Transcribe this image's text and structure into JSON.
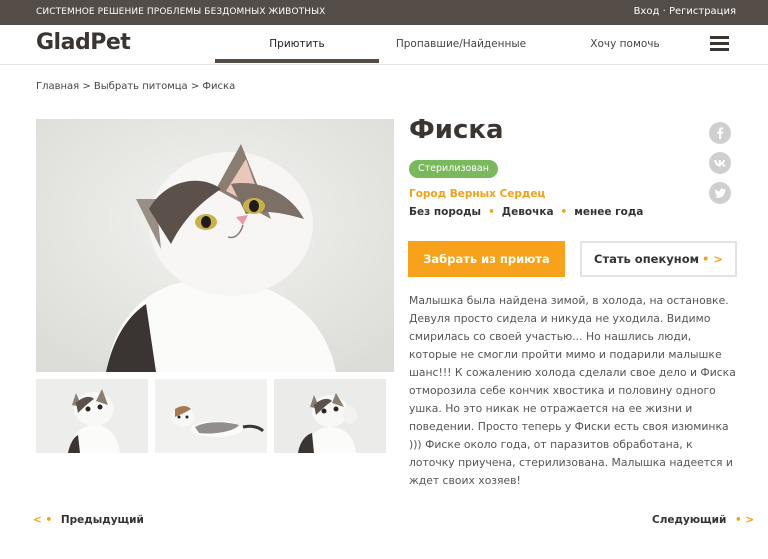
{
  "topbar": {
    "tagline": "СИСТЕМНОЕ РЕШЕНИЕ ПРОБЛЕМЫ БЕЗДОМНЫХ ЖИВОТНЫХ",
    "login": "Вход",
    "separator": "·",
    "register": "Регистрация"
  },
  "header": {
    "logo": "GladPet",
    "nav": [
      "Приютить",
      "Пропавшие/Найденные",
      "Хочу помочь"
    ],
    "active_index": 0
  },
  "breadcrumb": "Главная > Выбрать питомца > Фиска",
  "pet": {
    "name": "Фиска",
    "status_badge": "Стерилизован",
    "shelter": "Город Верных Сердец",
    "breed": "Без породы",
    "sex": "Девочка",
    "age": "менее года",
    "trait_separator": "•",
    "description": "Малышка была найдена зимой, в холода, на остановке. Девуля просто сидела и никуда не уходила. Видимо смирилась со своей участью... Но нашлись люди, которые не смогли пройти мимо и подарили малышке шанс!!! К сожалению холода сделали свое дело и Фиска отморозила себе кончик хвостика и половину одного ушка. Но это никак не отражается на ее жизни и поведении. Просто теперь у Фиски есть своя изюминка ))) Фиске около года, от паразитов обработана, к лоточку приучена, стерилизована. Малышка надеется и ждет своих хозяев!"
  },
  "actions": {
    "adopt": "Забрать из приюта",
    "guardian": "Стать опекуном",
    "guardian_arrow": "• >"
  },
  "social": [
    "facebook-icon",
    "vk-icon",
    "twitter-icon"
  ],
  "pager": {
    "prev": "Предыдущий",
    "prev_arrow": "< •",
    "next": "Следующий",
    "next_arrow": "• >"
  },
  "colors": {
    "topbar": "#544c47",
    "accent": "#f7a21a",
    "badge": "#7ab85e"
  }
}
